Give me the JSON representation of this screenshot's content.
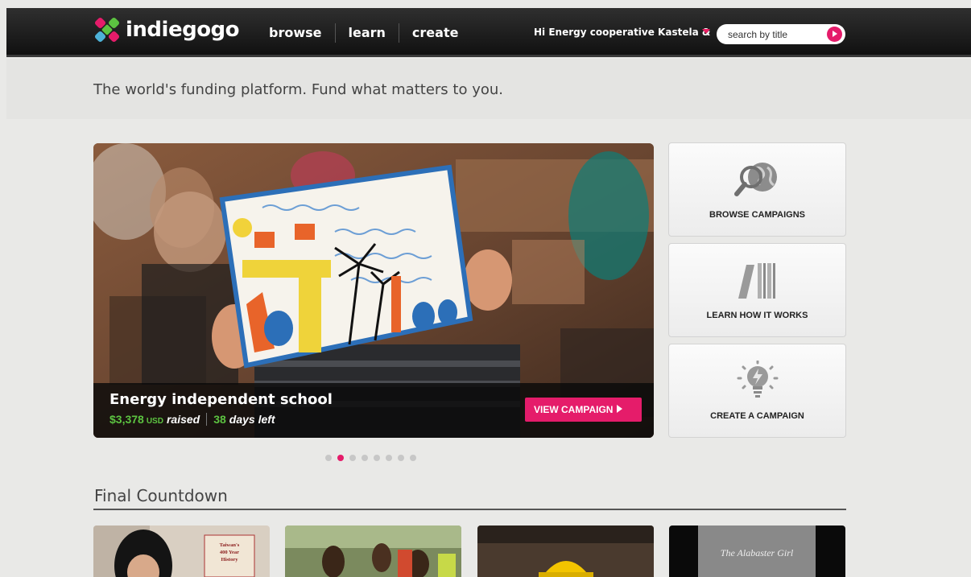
{
  "header": {
    "logo_text": "indiegogo",
    "nav": [
      "browse",
      "learn",
      "create"
    ],
    "greeting": "Hi Energy cooperative Kastela &",
    "search_placeholder": "search by title"
  },
  "tagline": "The world's funding platform. Fund what matters to you.",
  "hero": {
    "title": "Energy independent school",
    "amount": "$3,378",
    "currency": "USD",
    "raised_label": "raised",
    "days": "38",
    "days_label": "days left",
    "button": "VIEW CAMPAIGN",
    "slide_count": 8,
    "active_slide": 1
  },
  "side_buttons": [
    {
      "label": "BROWSE CAMPAIGNS",
      "icon": "globe-search-icon"
    },
    {
      "label": "LEARN HOW IT WORKS",
      "icon": "books-icon"
    },
    {
      "label": "CREATE A CAMPAIGN",
      "icon": "lightbulb-icon"
    }
  ],
  "section": {
    "title": "Final Countdown",
    "thumbnails": [
      {
        "caption": "Taiwan's 400 Year History"
      },
      {
        "caption": ""
      },
      {
        "caption": ""
      },
      {
        "caption": "The Alabaster Girl"
      }
    ]
  },
  "colors": {
    "accent": "#e51c6a",
    "money": "#5cc341",
    "topbar": "#1a1a1a"
  }
}
